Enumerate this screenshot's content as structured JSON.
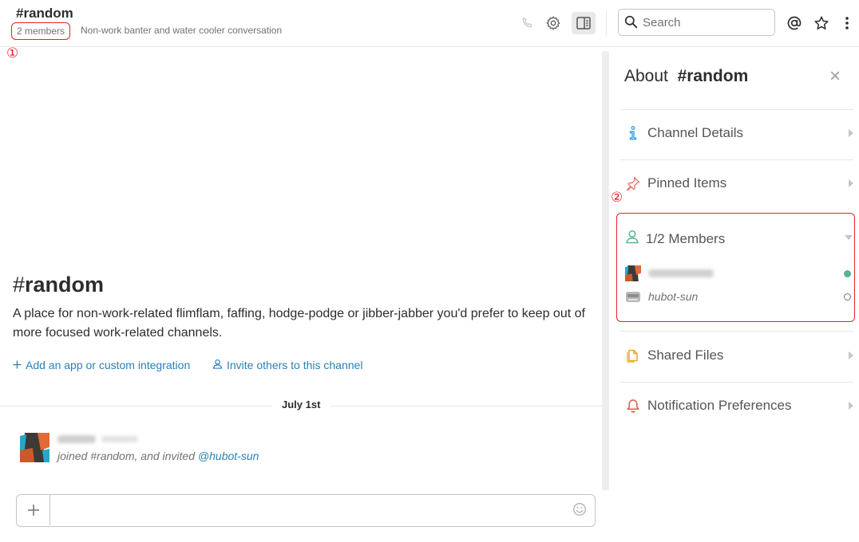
{
  "header": {
    "channel_name": "#random",
    "members_link": "2 members",
    "purpose": "Non-work banter and water cooler conversation",
    "search_placeholder": "Search",
    "icons": [
      "phone-icon",
      "gear-icon",
      "sidebar-toggle-icon",
      "search-icon",
      "mentions-icon",
      "star-icon",
      "more-icon"
    ]
  },
  "annotations": {
    "one": "①",
    "two": "②",
    "color": "#e8202a"
  },
  "main": {
    "intro_hash": "#",
    "intro_name": "random",
    "intro_description": "A place for non-work-related flimflam, faffing, hodge-podge or jibber-jabber you'd prefer to keep out of more focused work-related channels.",
    "add_app_label": "Add an app or custom integration",
    "invite_label": "Invite others to this channel",
    "day_divider": "July 1st",
    "message": {
      "text_prefix": "joined #random, and invited ",
      "mention": "@hubot-sun"
    },
    "composer_placeholder": ""
  },
  "sidebar": {
    "about_prefix": "About",
    "about_channel": "#random",
    "close_label": "×",
    "sections": {
      "channel_details": "Channel Details",
      "pinned_items": "Pinned Items",
      "members": "1/2 Members",
      "shared_files": "Shared Files",
      "notification_prefs": "Notification Preferences"
    },
    "members_list": [
      {
        "name": "",
        "presence": "active"
      },
      {
        "name": "hubot-sun",
        "presence": "away"
      }
    ]
  },
  "colors": {
    "link": "#2a80b9",
    "presence_active": "#56b68b",
    "highlight": "#e8202a"
  }
}
